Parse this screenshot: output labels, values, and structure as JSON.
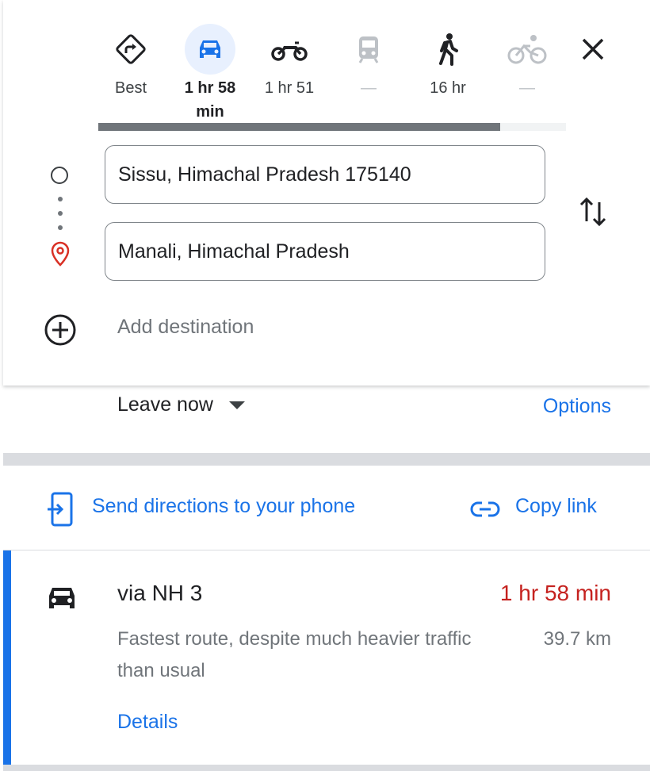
{
  "modes": [
    {
      "id": "best",
      "icon": "best-route-icon",
      "label": "Best",
      "selected": false,
      "disabled": false
    },
    {
      "id": "driving",
      "icon": "car-icon",
      "label": "1 hr 58 min",
      "selected": true,
      "disabled": false
    },
    {
      "id": "motorcycle",
      "icon": "motorcycle-icon",
      "label": "1 hr 51",
      "selected": false,
      "disabled": false
    },
    {
      "id": "transit",
      "icon": "train-icon",
      "label": "—",
      "selected": false,
      "disabled": true
    },
    {
      "id": "walking",
      "icon": "walking-icon",
      "label": "16 hr",
      "selected": false,
      "disabled": false
    },
    {
      "id": "cycling",
      "icon": "bicycle-icon",
      "label": "—",
      "selected": false,
      "disabled": true
    }
  ],
  "progress": 0.86,
  "origin": {
    "value": "Sissu, Himachal Pradesh 175140"
  },
  "destination": {
    "value": "Manali, Himachal Pradesh"
  },
  "add_destination": "Add destination",
  "leave": {
    "label": "Leave now"
  },
  "options_label": "Options",
  "share": {
    "send_label": "Send directions to your phone",
    "copy_label": "Copy link"
  },
  "route": {
    "via": "via NH 3",
    "time": "1 hr 58 min",
    "description": "Fastest route, despite much heavier traffic than usual",
    "distance": "39.7 km",
    "details_label": "Details"
  },
  "colors": {
    "accent": "#1a73e8",
    "traffic_delay": "#c5221f",
    "selected_mode_bg": "#e8f0fe"
  }
}
